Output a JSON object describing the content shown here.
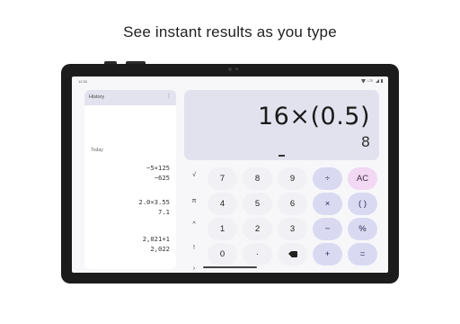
{
  "headline": "See instant results as you type",
  "statusbar": {
    "time": "12:30",
    "network": "LTE"
  },
  "history": {
    "title": "History",
    "menu_icon": "more-vert-icon",
    "section_label": "Today",
    "entries": [
      {
        "expression": "−5×125",
        "result": "−625"
      },
      {
        "expression": "2.0×3.55",
        "result": "7.1"
      },
      {
        "expression": "2,021+1",
        "result": "2,022"
      }
    ]
  },
  "display": {
    "expression": "16×(0.5)",
    "result": "8"
  },
  "scientific_keys": [
    "√",
    "π",
    "^",
    "!",
    "›"
  ],
  "keypad": {
    "row1": [
      "7",
      "8",
      "9",
      "÷",
      "AC"
    ],
    "row2": [
      "4",
      "5",
      "6",
      "×",
      "( )"
    ],
    "row3": [
      "1",
      "2",
      "3",
      "−",
      "%"
    ],
    "row4": [
      "0",
      "·",
      "backspace-icon",
      "+",
      "="
    ]
  },
  "colors": {
    "display_bg": "#e2e2ef",
    "operator_key": "#d9daf2",
    "clear_key": "#f3d8f3",
    "number_key": "#f1f1f5",
    "bezel": "#1c1c1c"
  }
}
